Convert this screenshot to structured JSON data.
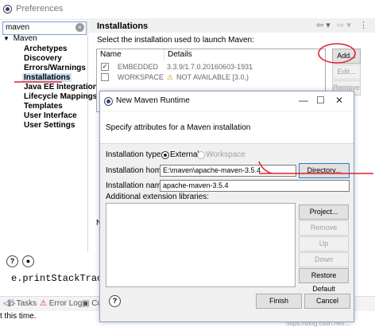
{
  "preferences": {
    "title": "Preferences",
    "filter_value": "maven",
    "tree": {
      "root": "Maven",
      "items": [
        "Archetypes",
        "Discovery",
        "Errors/Warnings",
        "Installations",
        "Java EE Integration",
        "Lifecycle Mappings",
        "Templates",
        "User Interface",
        "User Settings"
      ],
      "selected": "Installations"
    },
    "page_title": "Installations",
    "select_label": "Select the installation used to launch Maven:",
    "table": {
      "columns": [
        "Name",
        "Details"
      ],
      "rows": [
        {
          "name": "EMBEDDED",
          "details": "3.3.9/1.7.0.20160603-1931",
          "checked": true
        },
        {
          "name": "WORKSPACE",
          "details": "NOT AVAILABLE [3.0,)",
          "checked": false
        }
      ]
    },
    "buttons": {
      "add": "Add...",
      "edit": "Edit...",
      "remove": "Remove"
    },
    "partial_label": "N",
    "code_line": "e.printStackTrace",
    "bottom_tabs": [
      "Tasks",
      "Error Log",
      "Co"
    ],
    "status_line": "t this time."
  },
  "dialog": {
    "title": "New Maven Runtime",
    "description": "Specify attributes for a Maven installation",
    "install_type_label": "Installation type:",
    "type_external": "External",
    "type_workspace": "Workspace",
    "install_home_label": "Installation home:",
    "install_home_value": "E:\\maven\\apache-maven-3.5.4",
    "directory_button": "Directory...",
    "install_name_label": "Installation name:",
    "install_name_value": "apache-maven-3.5.4",
    "ext_libs_label": "Additional extension libraries:",
    "buttons": {
      "project": "Project...",
      "remove": "Remove",
      "up": "Up",
      "down": "Down",
      "restore": "Restore Default",
      "finish": "Finish",
      "cancel": "Cancel"
    },
    "help_icon": "?"
  },
  "watermark": "https://blog.csdn.net/..."
}
